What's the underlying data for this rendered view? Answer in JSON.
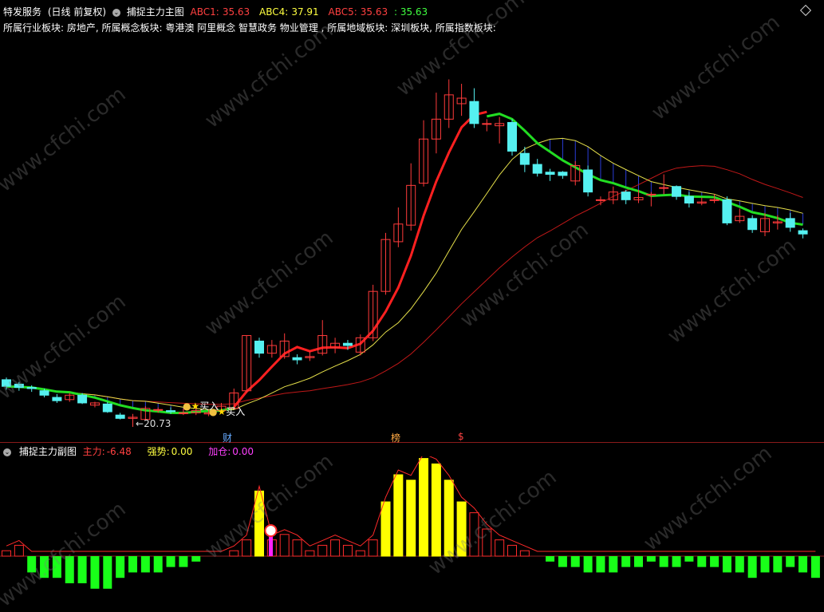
{
  "header": {
    "service": "特发服务",
    "period": "(日线 前复权)",
    "indicator": "捕捉主力主图",
    "abc1_label": "ABC1:",
    "abc1_value": "35.63",
    "abc4_label": "ABC4:",
    "abc4_value": "37.91",
    "abc5_label": "ABC5:",
    "abc5_value": "35.63",
    "abc5_extra": ": 35.63"
  },
  "sector_line": "所属行业板块: 房地产, 所属概念板块: 粤港澳 阿里概念 智慧政务 物业管理 , 所属地域板块: 深圳板块, 所属指数板块:",
  "main_chart": {
    "low_annotation": "20.73",
    "buy_signal_1": "买入",
    "buy_signal_2": "买入",
    "event_markers": [
      "财",
      "榜",
      "$"
    ]
  },
  "sub_chart": {
    "title": "捕捉主力副图",
    "main_force_label": "主力:",
    "main_force_value": "-6.48",
    "strength_label": "强势:",
    "strength_value": "0.00",
    "add_label": "加仓:",
    "add_value": "0.00"
  },
  "watermark": "www.cfchi.com",
  "colors": {
    "up": "#ff3b3b",
    "down": "#55f0f0",
    "ma_yellow": "#e6e04a",
    "ma_green": "#22dd22",
    "ma_red": "#ff2020",
    "ma_darkred": "#c01818",
    "bar_yellow": "#ffff00",
    "bar_green": "#19ff19",
    "bar_red": "#ff2a2a",
    "magenta": "#ff22ff"
  },
  "chart_data": {
    "type": "candlestick",
    "candles": [
      {
        "o": 25.0,
        "c": 24.4,
        "h": 25.2,
        "l": 24.1
      },
      {
        "o": 24.6,
        "c": 24.3,
        "h": 24.8,
        "l": 24.0
      },
      {
        "o": 24.3,
        "c": 24.2,
        "h": 24.5,
        "l": 23.9
      },
      {
        "o": 24.0,
        "c": 23.6,
        "h": 24.2,
        "l": 23.4
      },
      {
        "o": 23.4,
        "c": 23.1,
        "h": 23.7,
        "l": 22.9
      },
      {
        "o": 23.2,
        "c": 23.6,
        "h": 23.8,
        "l": 23.0
      },
      {
        "o": 23.6,
        "c": 22.9,
        "h": 23.8,
        "l": 22.8
      },
      {
        "o": 22.7,
        "c": 22.9,
        "h": 23.0,
        "l": 22.5
      },
      {
        "o": 22.8,
        "c": 22.1,
        "h": 23.0,
        "l": 22.0
      },
      {
        "o": 21.8,
        "c": 21.5,
        "h": 22.0,
        "l": 21.4
      },
      {
        "o": 21.5,
        "c": 21.6,
        "h": 21.9,
        "l": 20.73
      },
      {
        "o": 21.4,
        "c": 22.4,
        "h": 22.6,
        "l": 21.3
      },
      {
        "o": 22.3,
        "c": 22.3,
        "h": 22.5,
        "l": 22.0
      },
      {
        "o": 22.2,
        "c": 22.1,
        "h": 22.5,
        "l": 21.9
      },
      {
        "o": 22.0,
        "c": 22.0,
        "h": 22.4,
        "l": 21.8
      },
      {
        "o": 22.0,
        "c": 22.2,
        "h": 22.5,
        "l": 21.8
      },
      {
        "o": 21.9,
        "c": 22.0,
        "h": 22.3,
        "l": 21.7
      },
      {
        "o": 22.2,
        "c": 22.6,
        "h": 22.9,
        "l": 22.0
      },
      {
        "o": 22.4,
        "c": 23.8,
        "h": 24.2,
        "l": 22.3
      },
      {
        "o": 24.0,
        "c": 29.0,
        "h": 29.0,
        "l": 23.8
      },
      {
        "o": 28.5,
        "c": 27.4,
        "h": 28.8,
        "l": 27.0
      },
      {
        "o": 27.4,
        "c": 28.1,
        "h": 28.6,
        "l": 27.0
      },
      {
        "o": 27.1,
        "c": 28.5,
        "h": 29.2,
        "l": 26.9
      },
      {
        "o": 27.0,
        "c": 26.8,
        "h": 27.3,
        "l": 26.4
      },
      {
        "o": 27.0,
        "c": 27.1,
        "h": 27.6,
        "l": 26.7
      },
      {
        "o": 27.4,
        "c": 29.0,
        "h": 30.4,
        "l": 27.2
      },
      {
        "o": 27.9,
        "c": 28.3,
        "h": 28.8,
        "l": 27.4
      },
      {
        "o": 28.3,
        "c": 28.1,
        "h": 28.6,
        "l": 27.7
      },
      {
        "o": 27.5,
        "c": 28.8,
        "h": 29.1,
        "l": 27.2
      },
      {
        "o": 28.8,
        "c": 33.0,
        "h": 33.6,
        "l": 28.5
      },
      {
        "o": 33.0,
        "c": 37.7,
        "h": 38.3,
        "l": 32.7
      },
      {
        "o": 37.5,
        "c": 39.1,
        "h": 40.6,
        "l": 37.0
      },
      {
        "o": 39.0,
        "c": 42.6,
        "h": 44.6,
        "l": 38.5
      },
      {
        "o": 42.8,
        "c": 46.8,
        "h": 48.5,
        "l": 42.5
      },
      {
        "o": 46.8,
        "c": 48.6,
        "h": 51.0,
        "l": 45.5
      },
      {
        "o": 48.6,
        "c": 50.8,
        "h": 52.2,
        "l": 47.8
      },
      {
        "o": 50.0,
        "c": 50.5,
        "h": 51.8,
        "l": 48.9
      },
      {
        "o": 50.2,
        "c": 48.2,
        "h": 51.4,
        "l": 47.8
      },
      {
        "o": 48.2,
        "c": 48.2,
        "h": 48.6,
        "l": 47.5
      },
      {
        "o": 48.0,
        "c": 48.2,
        "h": 48.8,
        "l": 46.4
      },
      {
        "o": 48.3,
        "c": 45.7,
        "h": 48.6,
        "l": 45.3
      },
      {
        "o": 45.5,
        "c": 44.5,
        "h": 46.1,
        "l": 43.8
      },
      {
        "o": 44.5,
        "c": 43.7,
        "h": 45.0,
        "l": 43.4
      },
      {
        "o": 43.8,
        "c": 43.6,
        "h": 44.1,
        "l": 43.0
      },
      {
        "o": 43.8,
        "c": 43.5,
        "h": 43.9,
        "l": 43.2
      },
      {
        "o": 43.0,
        "c": 44.4,
        "h": 44.8,
        "l": 42.6
      },
      {
        "o": 44.0,
        "c": 42.0,
        "h": 44.4,
        "l": 41.6
      },
      {
        "o": 41.3,
        "c": 41.3,
        "h": 41.6,
        "l": 40.8
      },
      {
        "o": 41.3,
        "c": 42.0,
        "h": 42.5,
        "l": 40.9
      },
      {
        "o": 42.0,
        "c": 41.3,
        "h": 42.2,
        "l": 40.9
      },
      {
        "o": 41.3,
        "c": 41.5,
        "h": 42.2,
        "l": 41.0
      },
      {
        "o": 41.8,
        "c": 41.8,
        "h": 42.0,
        "l": 40.7
      },
      {
        "o": 42.4,
        "c": 42.4,
        "h": 43.6,
        "l": 41.8
      },
      {
        "o": 42.5,
        "c": 41.6,
        "h": 42.6,
        "l": 41.3
      },
      {
        "o": 41.6,
        "c": 41.0,
        "h": 42.0,
        "l": 40.6
      },
      {
        "o": 41.0,
        "c": 41.1,
        "h": 41.5,
        "l": 40.8
      },
      {
        "o": 41.3,
        "c": 41.3,
        "h": 41.8,
        "l": 41.0
      },
      {
        "o": 41.3,
        "c": 39.2,
        "h": 41.6,
        "l": 39.0
      },
      {
        "o": 39.4,
        "c": 39.8,
        "h": 40.5,
        "l": 39.2
      },
      {
        "o": 39.6,
        "c": 38.6,
        "h": 39.9,
        "l": 38.3
      },
      {
        "o": 38.4,
        "c": 39.6,
        "h": 40.1,
        "l": 38.0
      },
      {
        "o": 39.2,
        "c": 39.3,
        "h": 39.9,
        "l": 38.6
      },
      {
        "o": 39.6,
        "c": 38.8,
        "h": 40.1,
        "l": 38.4
      },
      {
        "o": 38.5,
        "c": 38.2,
        "h": 38.7,
        "l": 37.8
      }
    ],
    "sub_bars": [
      1,
      2,
      -3,
      -4,
      -4,
      -5,
      -5,
      -6,
      -6,
      -4,
      -3,
      -3,
      -3,
      -2,
      -2,
      -1,
      0,
      0,
      1,
      3,
      12,
      3,
      4,
      3,
      1,
      2,
      3,
      2,
      1,
      3,
      10,
      15,
      14,
      18,
      17,
      14,
      10,
      8,
      5,
      3,
      2,
      1,
      0,
      -1,
      -2,
      -2,
      -3,
      -3,
      -3,
      -2,
      -2,
      -1,
      -2,
      -2,
      -1,
      -2,
      -2,
      -3,
      -3,
      -4,
      -3,
      -3,
      -2,
      -3,
      -4
    ],
    "price_range": [
      19.5,
      56.5
    ]
  }
}
